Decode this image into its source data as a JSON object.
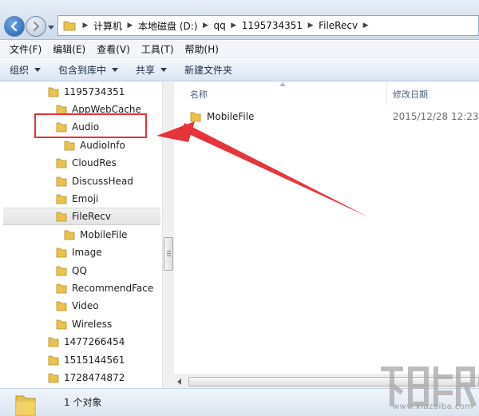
{
  "address_bar": {
    "breadcrumbs": [
      "计算机",
      "本地磁盘 (D:)",
      "qq",
      "1195734351",
      "FileRecv"
    ]
  },
  "menu": {
    "items": [
      "文件(F)",
      "编辑(E)",
      "查看(V)",
      "工具(T)",
      "帮助(H)"
    ]
  },
  "toolbar": {
    "organize": "组织",
    "include_in_library": "包含到库中",
    "share": "共享",
    "new_folder": "新建文件夹"
  },
  "nav_tree": {
    "items": [
      {
        "label": "1195734351",
        "level": 0
      },
      {
        "label": "AppWebCache",
        "level": 1
      },
      {
        "label": "Audio",
        "level": 1
      },
      {
        "label": "AudioInfo",
        "level": 2
      },
      {
        "label": "CloudRes",
        "level": 1
      },
      {
        "label": "DiscussHead",
        "level": 1
      },
      {
        "label": "Emoji",
        "level": 1
      },
      {
        "label": "FileRecv",
        "level": 1,
        "selected": true
      },
      {
        "label": "MobileFile",
        "level": 2
      },
      {
        "label": "Image",
        "level": 1
      },
      {
        "label": "QQ",
        "level": 1
      },
      {
        "label": "RecommendFace",
        "level": 1
      },
      {
        "label": "Video",
        "level": 1
      },
      {
        "label": "Wireless",
        "level": 1
      },
      {
        "label": "1477266454",
        "level": 0
      },
      {
        "label": "1515144561",
        "level": 0
      },
      {
        "label": "1728474872",
        "level": 0
      }
    ]
  },
  "content": {
    "columns": {
      "name": "名称",
      "date_modified": "修改日期"
    },
    "rows": [
      {
        "name": "MobileFile",
        "date_modified": "2015/12/28 12:23"
      }
    ]
  },
  "status_bar": {
    "text": "1 个对象"
  },
  "colors": {
    "annotation_red": "#e6343a",
    "folder_yellow": "#e9c24f"
  },
  "watermark": {
    "text": "www.xiazaiba.com"
  }
}
